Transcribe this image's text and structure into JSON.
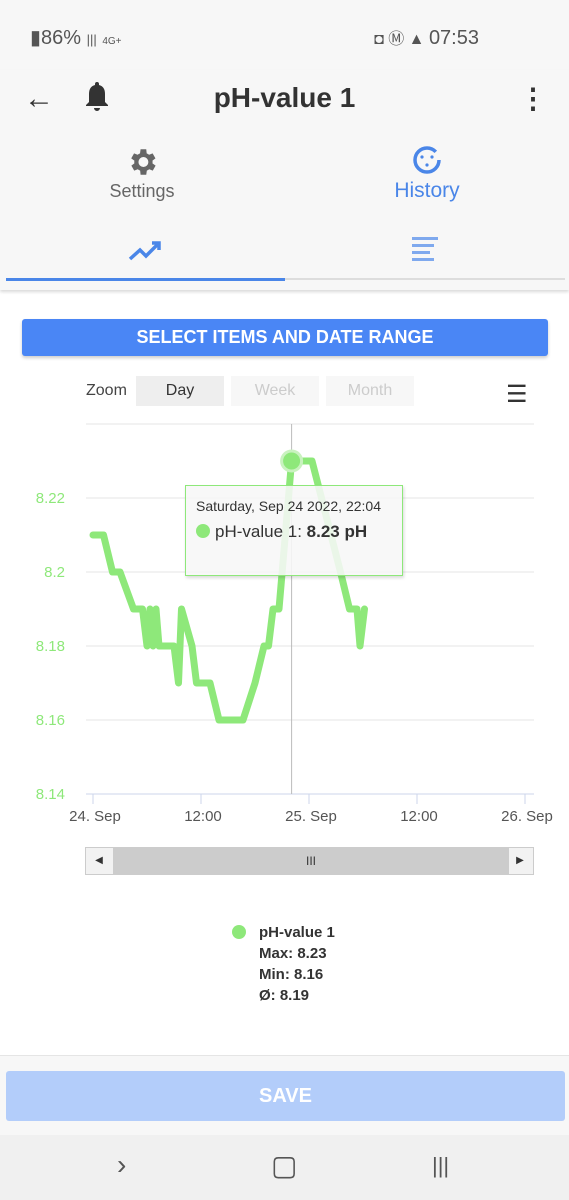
{
  "status": {
    "battery": "86%",
    "network": "4G+",
    "time": "07:53"
  },
  "header": {
    "title": "pH-value 1"
  },
  "tabs": [
    {
      "label": "Settings",
      "icon": "gear-icon",
      "active": false
    },
    {
      "label": "History",
      "icon": "history-icon",
      "active": true
    }
  ],
  "subtabs": [
    {
      "icon": "trending-up-icon",
      "active": true
    },
    {
      "icon": "list-icon",
      "active": false
    }
  ],
  "select_button": "SELECT ITEMS AND DATE RANGE",
  "zoom": {
    "label": "Zoom",
    "options": [
      "Day",
      "Week",
      "Month"
    ],
    "selected": "Day"
  },
  "colors": {
    "accent": "#4a86e8",
    "series": "#8ee87a"
  },
  "tooltip": {
    "date": "Saturday, Sep 24 2022, 22:04",
    "series": "pH-value 1: ",
    "value": "8.23 pH"
  },
  "chart_data": {
    "type": "line",
    "ylim": [
      8.14,
      8.24
    ],
    "yticks": [
      "8.14",
      "8.16",
      "8.18",
      "8.2",
      "8.22"
    ],
    "xticks": [
      "24. Sep",
      "12:00",
      "25. Sep",
      "12:00",
      "26. Sep"
    ],
    "xrange": [
      "2022-09-24 00:00",
      "2022-09-26 00:00"
    ],
    "grid": true,
    "series": [
      {
        "name": "pH-value 1",
        "points": [
          [
            "2022-09-24 00:00",
            8.21
          ],
          [
            "2022-09-24 01:10",
            8.21
          ],
          [
            "2022-09-24 02:10",
            8.2
          ],
          [
            "2022-09-24 03:00",
            8.2
          ],
          [
            "2022-09-24 04:30",
            8.19
          ],
          [
            "2022-09-24 05:30",
            8.19
          ],
          [
            "2022-09-24 06:00",
            8.18
          ],
          [
            "2022-09-24 06:20",
            8.19
          ],
          [
            "2022-09-24 06:40",
            8.18
          ],
          [
            "2022-09-24 07:00",
            8.19
          ],
          [
            "2022-09-24 07:20",
            8.18
          ],
          [
            "2022-09-24 09:00",
            8.18
          ],
          [
            "2022-09-24 09:30",
            8.17
          ],
          [
            "2022-09-24 09:50",
            8.19
          ],
          [
            "2022-09-24 11:00",
            8.18
          ],
          [
            "2022-09-24 11:30",
            8.17
          ],
          [
            "2022-09-24 13:00",
            8.17
          ],
          [
            "2022-09-24 14:00",
            8.16
          ],
          [
            "2022-09-24 16:40",
            8.16
          ],
          [
            "2022-09-24 18:00",
            8.17
          ],
          [
            "2022-09-24 19:00",
            8.18
          ],
          [
            "2022-09-24 19:30",
            8.18
          ],
          [
            "2022-09-24 20:00",
            8.19
          ],
          [
            "2022-09-24 20:40",
            8.19
          ],
          [
            "2022-09-24 22:04",
            8.23
          ],
          [
            "2022-09-25 00:20",
            8.23
          ],
          [
            "2022-09-25 03:30",
            8.2
          ],
          [
            "2022-09-25 04:30",
            8.19
          ],
          [
            "2022-09-25 05:20",
            8.19
          ],
          [
            "2022-09-25 05:40",
            8.18
          ],
          [
            "2022-09-25 06:10",
            8.19
          ]
        ]
      }
    ]
  },
  "legend": {
    "name": "pH-value 1",
    "max": "Max: 8.23",
    "min": "Min: 8.16",
    "avg": "Ø: 8.19"
  },
  "save_label": "SAVE"
}
